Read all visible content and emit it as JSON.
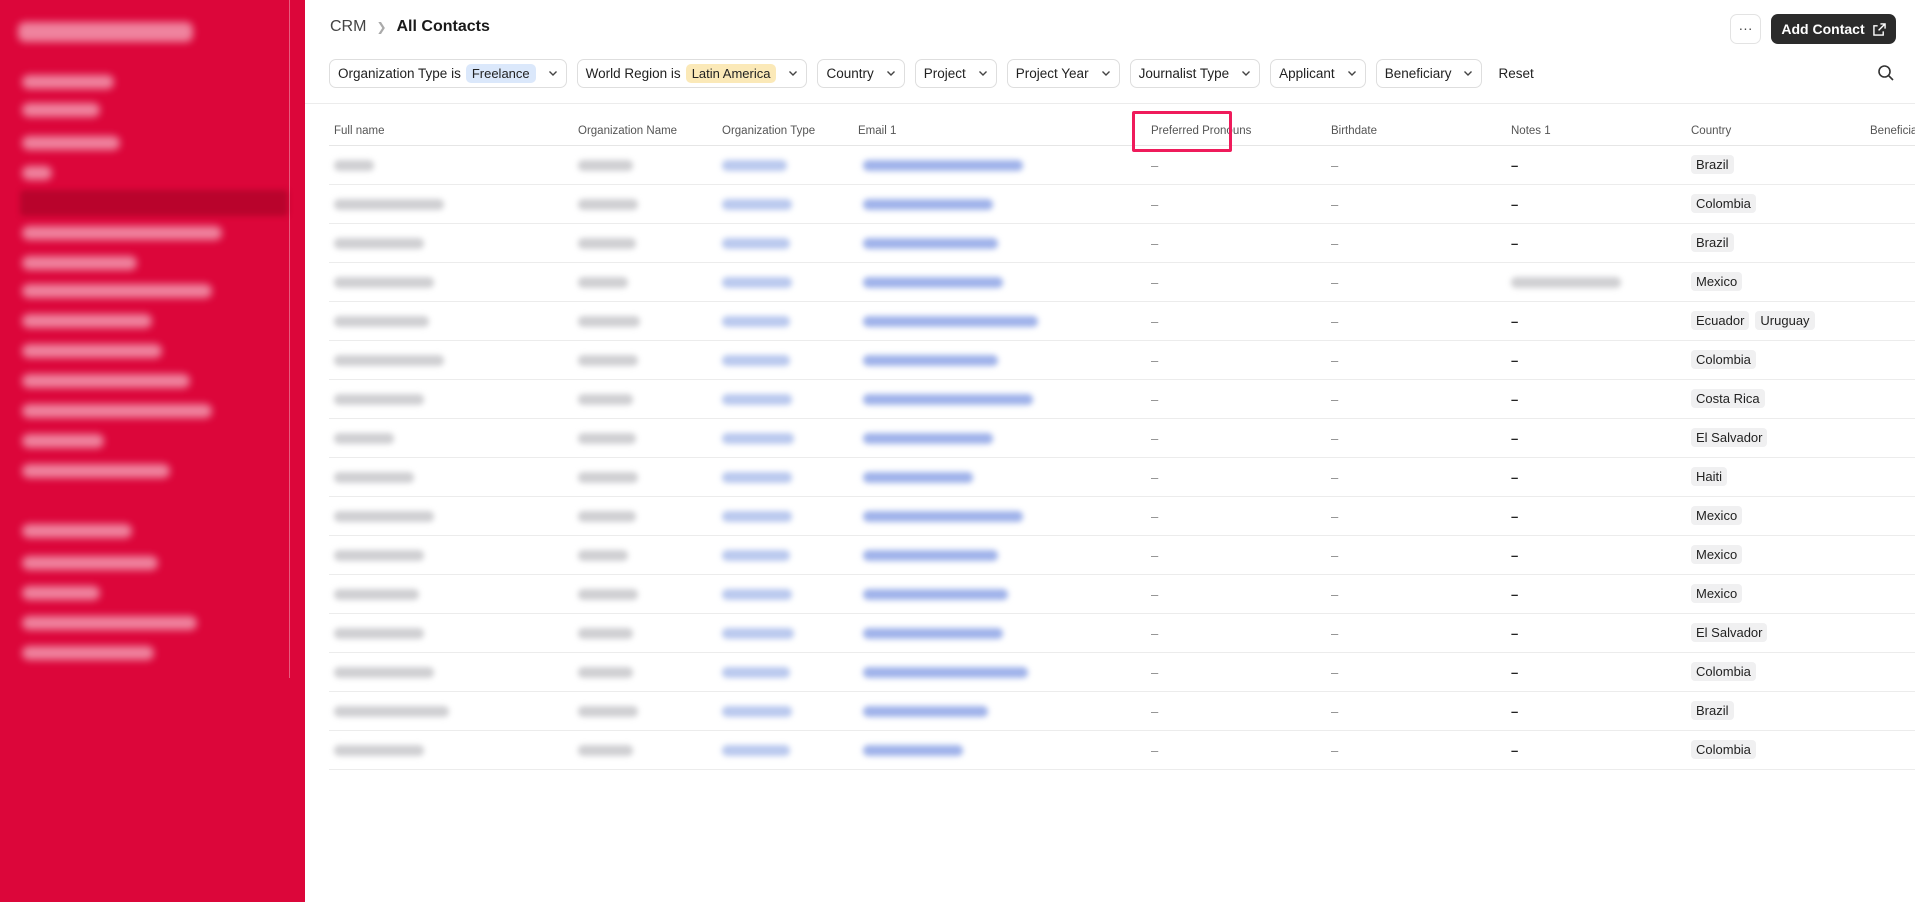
{
  "breadcrumb": {
    "root": "CRM",
    "current": "All Contacts"
  },
  "header": {
    "more_label": "···",
    "add_contact_label": "Add Contact"
  },
  "filters": [
    {
      "label": "Organization Type is",
      "value": "Freelance",
      "value_color": "blue"
    },
    {
      "label": "World Region is",
      "value": "Latin America",
      "value_color": "yellow"
    },
    {
      "label": "Country"
    },
    {
      "label": "Project"
    },
    {
      "label": "Project Year"
    },
    {
      "label": "Journalist Type"
    },
    {
      "label": "Applicant"
    },
    {
      "label": "Beneficiary"
    }
  ],
  "reset_label": "Reset",
  "columns": [
    "Full name",
    "Organization Name",
    "Organization Type",
    "Email 1",
    "Preferred Pronouns",
    "Birthdate",
    "Notes 1",
    "Country",
    "Beneficiary"
  ],
  "dash": "–",
  "dash_bold": "–",
  "rows": [
    {
      "countries": [
        "Brazil"
      ]
    },
    {
      "countries": [
        "Colombia"
      ]
    },
    {
      "countries": [
        "Brazil"
      ]
    },
    {
      "countries": [
        "Mexico"
      ],
      "notes_blurred": true
    },
    {
      "countries": [
        "Ecuador",
        "Uruguay"
      ]
    },
    {
      "countries": [
        "Colombia"
      ]
    },
    {
      "countries": [
        "Costa Rica"
      ]
    },
    {
      "countries": [
        "El Salvador"
      ]
    },
    {
      "countries": [
        "Haiti"
      ]
    },
    {
      "countries": [
        "Mexico"
      ]
    },
    {
      "countries": [
        "Mexico"
      ]
    },
    {
      "countries": [
        "Mexico"
      ]
    },
    {
      "countries": [
        "El Salvador"
      ]
    },
    {
      "countries": [
        "Colombia"
      ]
    },
    {
      "countries": [
        "Brazil"
      ]
    },
    {
      "countries": [
        "Colombia"
      ]
    }
  ],
  "colors": {
    "sidebar": "#dc063a",
    "highlight": "#ef1b5b",
    "button_dark": "#2b2b2b"
  },
  "icons": [
    "more-icon",
    "external-link-icon",
    "chevron-down-icon",
    "search-icon"
  ]
}
